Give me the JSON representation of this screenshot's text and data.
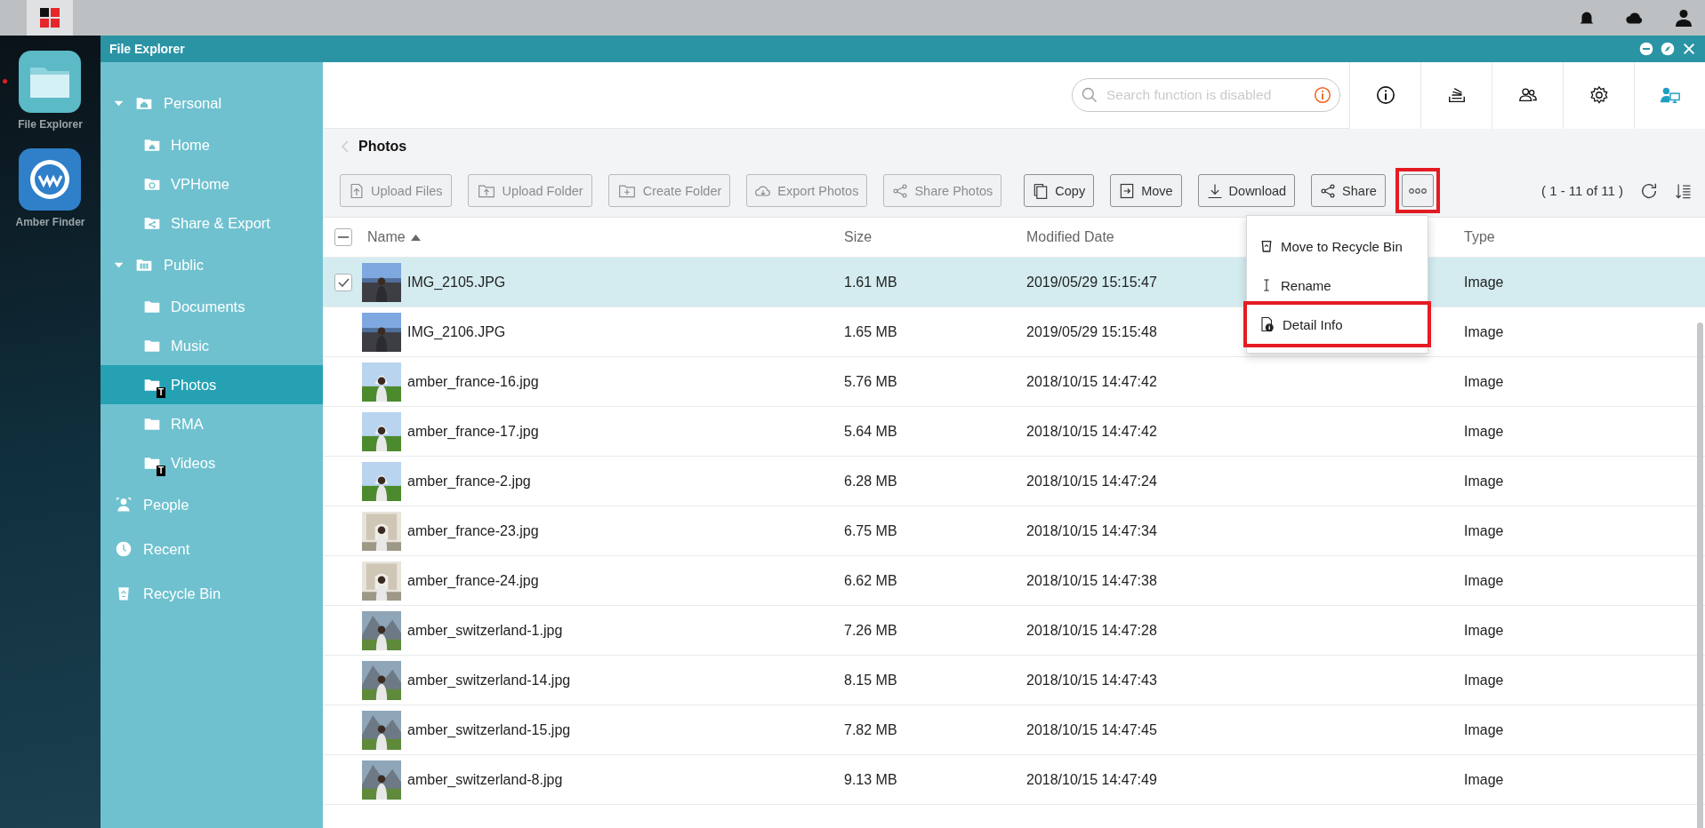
{
  "dock": {
    "apps": [
      {
        "label": "File Explorer",
        "kind": "files",
        "running": true
      },
      {
        "label": "Amber Finder",
        "kind": "finder",
        "running": false
      }
    ]
  },
  "window": {
    "title": "File Explorer"
  },
  "sidebar": {
    "items": [
      {
        "label": "Personal",
        "kind": "personal",
        "expanded": true,
        "selected": false,
        "children": [
          {
            "label": "Home",
            "kind": "home",
            "selected": false
          },
          {
            "label": "VPHome",
            "kind": "vphome",
            "selected": false
          },
          {
            "label": "Share & Export",
            "kind": "share",
            "selected": false
          }
        ]
      },
      {
        "label": "Public",
        "kind": "public",
        "expanded": true,
        "selected": false,
        "children": [
          {
            "label": "Documents",
            "kind": "folder",
            "selected": false
          },
          {
            "label": "Music",
            "kind": "folder",
            "selected": false
          },
          {
            "label": "Photos",
            "kind": "folder",
            "badge": "T",
            "selected": true
          },
          {
            "label": "RMA",
            "kind": "folder",
            "selected": false
          },
          {
            "label": "Videos",
            "kind": "folder",
            "badge": "T",
            "selected": false
          }
        ]
      },
      {
        "label": "People",
        "kind": "people",
        "selected": false
      },
      {
        "label": "Recent",
        "kind": "recent",
        "selected": false
      },
      {
        "label": "Recycle Bin",
        "kind": "recycle",
        "selected": false
      }
    ]
  },
  "search": {
    "placeholder": "Search function is disabled"
  },
  "breadcrumb": {
    "title": "Photos"
  },
  "toolbar": {
    "buttons": [
      {
        "label": "Upload Files",
        "kind": "upload",
        "disabled": true
      },
      {
        "label": "Upload Folder",
        "kind": "upload-folder",
        "disabled": true
      },
      {
        "label": "Create Folder",
        "kind": "create-folder",
        "disabled": true
      },
      {
        "label": "Export Photos",
        "kind": "export",
        "disabled": true
      },
      {
        "label": "Share Photos",
        "kind": "share",
        "disabled": true
      },
      {
        "label": "Copy",
        "kind": "copy",
        "disabled": false
      },
      {
        "label": "Move",
        "kind": "move",
        "disabled": false
      },
      {
        "label": "Download",
        "kind": "download",
        "disabled": false
      },
      {
        "label": "Share",
        "kind": "share",
        "disabled": false
      }
    ],
    "more_button": {
      "highlighted": true
    },
    "pagination": "( 1 - 11 of 11 )"
  },
  "table": {
    "header_checkbox": {
      "partial": true
    },
    "columns": [
      {
        "label": "Name",
        "sorted": true
      },
      {
        "label": "Size",
        "sorted": false
      },
      {
        "label": "Modified Date",
        "sorted": false
      },
      {
        "label": "Type",
        "sorted": false
      }
    ],
    "rows": [
      {
        "name": "IMG_2105.JPG",
        "size": "1.61 MB",
        "modified": "2019/05/29 15:15:47",
        "type": "Image",
        "selected": true
      },
      {
        "name": "IMG_2106.JPG",
        "size": "1.65 MB",
        "modified": "2019/05/29 15:15:48",
        "type": "Image",
        "selected": false
      },
      {
        "name": "amber_france-16.jpg",
        "size": "5.76 MB",
        "modified": "2018/10/15 14:47:42",
        "type": "Image",
        "selected": false
      },
      {
        "name": "amber_france-17.jpg",
        "size": "5.64 MB",
        "modified": "2018/10/15 14:47:42",
        "type": "Image",
        "selected": false
      },
      {
        "name": "amber_france-2.jpg",
        "size": "6.28 MB",
        "modified": "2018/10/15 14:47:24",
        "type": "Image",
        "selected": false
      },
      {
        "name": "amber_france-23.jpg",
        "size": "6.75 MB",
        "modified": "2018/10/15 14:47:34",
        "type": "Image",
        "selected": false
      },
      {
        "name": "amber_france-24.jpg",
        "size": "6.62 MB",
        "modified": "2018/10/15 14:47:38",
        "type": "Image",
        "selected": false
      },
      {
        "name": "amber_switzerland-1.jpg",
        "size": "7.26 MB",
        "modified": "2018/10/15 14:47:28",
        "type": "Image",
        "selected": false
      },
      {
        "name": "amber_switzerland-14.jpg",
        "size": "8.15 MB",
        "modified": "2018/10/15 14:47:43",
        "type": "Image",
        "selected": false
      },
      {
        "name": "amber_switzerland-15.jpg",
        "size": "7.82 MB",
        "modified": "2018/10/15 14:47:45",
        "type": "Image",
        "selected": false
      },
      {
        "name": "amber_switzerland-8.jpg",
        "size": "9.13 MB",
        "modified": "2018/10/15 14:47:49",
        "type": "Image",
        "selected": false
      }
    ]
  },
  "menu": {
    "items": [
      {
        "label": "Move to Recycle Bin",
        "kind": "recycle",
        "highlighted": false
      },
      {
        "label": "Rename",
        "kind": "rename",
        "highlighted": false
      },
      {
        "label": "Detail Info",
        "kind": "info",
        "highlighted": true
      }
    ]
  }
}
